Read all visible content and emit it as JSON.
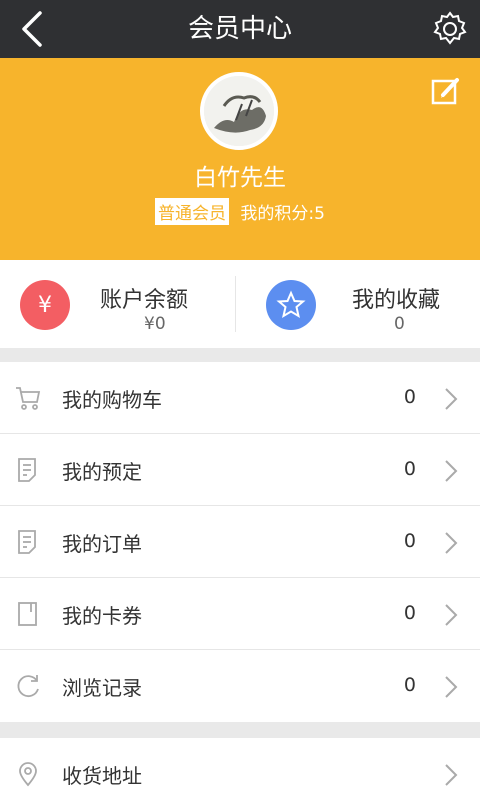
{
  "header": {
    "title": "会员中心",
    "back_icon": "back-chevron-icon",
    "settings_icon": "gear-icon"
  },
  "profile": {
    "username": "白竹先生",
    "member_level": "普通会员",
    "points_text": "我的积分:5",
    "edit_icon": "edit-icon",
    "accent_color": "#f7b42c"
  },
  "stats": {
    "balance": {
      "label": "账户余额",
      "value": "¥0",
      "icon_char": "¥",
      "icon": "yen-icon"
    },
    "favorites": {
      "label": "我的收藏",
      "value": "0",
      "icon": "star-icon"
    }
  },
  "menu": [
    {
      "label": "我的购物车",
      "count": "0",
      "icon": "cart-icon"
    },
    {
      "label": "我的预定",
      "count": "0",
      "icon": "document-icon"
    },
    {
      "label": "我的订单",
      "count": "0",
      "icon": "document-icon"
    },
    {
      "label": "我的卡券",
      "count": "0",
      "icon": "card-icon"
    },
    {
      "label": "浏览记录",
      "count": "0",
      "icon": "refresh-icon"
    }
  ],
  "menu2": [
    {
      "label": "收货地址",
      "icon": "location-pin-icon"
    }
  ]
}
